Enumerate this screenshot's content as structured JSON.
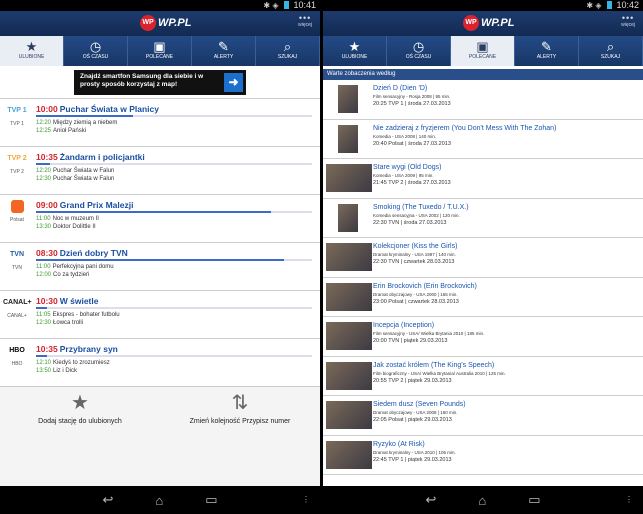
{
  "left": {
    "status_time": "10:41",
    "logo_text": "WP.PL",
    "more_label": "więcej",
    "tabs": [
      {
        "label": "ULUBIONE",
        "icon": "star-icon"
      },
      {
        "label": "OŚ CZASU",
        "icon": "clock-icon"
      },
      {
        "label": "POLECANE",
        "icon": "tv-icon"
      },
      {
        "label": "ALERTY",
        "icon": "pin-icon"
      },
      {
        "label": "SZUKAJ",
        "icon": "search-icon"
      }
    ],
    "ad_text": "Znajdź smartfon Samsung dla siebie i w prosty sposób korzystaj z map!",
    "channels": [
      {
        "name": "TVP 1",
        "logo": "TVP 1",
        "logo_color": "#4aa3df",
        "now_time": "10:00",
        "now_title": "Puchar Świata w Planicy",
        "progress": 0.35,
        "next": [
          {
            "time": "12:20",
            "title": "Między ziemią a niebem"
          },
          {
            "time": "12:25",
            "title": "Anioł Pański"
          }
        ]
      },
      {
        "name": "TVP 2",
        "logo": "TVP 2",
        "logo_color": "#f2a93b",
        "now_time": "10:35",
        "now_title": "Żandarm i policjantki",
        "progress": 0.05,
        "next": [
          {
            "time": "12:20",
            "title": "Puchar Świata w Falun"
          },
          {
            "time": "12:30",
            "title": "Puchar Świata w Falun"
          }
        ]
      },
      {
        "name": "Polsat",
        "logo": "",
        "logo_color": "#f26522",
        "now_time": "09:00",
        "now_title": "Grand Prix Malezji",
        "progress": 0.85,
        "next": [
          {
            "time": "11:00",
            "title": "Noc w muzeum II"
          },
          {
            "time": "13:30",
            "title": "Doktor Dolittle II"
          }
        ]
      },
      {
        "name": "TVN",
        "logo": "TVN",
        "logo_color": "#1f5fa8",
        "now_time": "08:30",
        "now_title": "Dzień dobry TVN",
        "progress": 0.9,
        "next": [
          {
            "time": "11:00",
            "title": "Perfekcyjna pani domu"
          },
          {
            "time": "12:00",
            "title": "Co za tydzień"
          }
        ]
      },
      {
        "name": "CANAL+",
        "logo": "CANAL+",
        "logo_color": "#222222",
        "now_time": "10:30",
        "now_title": "W świetle",
        "progress": 0.04,
        "next": [
          {
            "time": "11:05",
            "title": "Ekspres - bohater futbolu"
          },
          {
            "time": "12:30",
            "title": "Łowca trolli"
          }
        ]
      },
      {
        "name": "HBO",
        "logo": "HBO",
        "logo_color": "#000000",
        "now_time": "10:35",
        "now_title": "Przybrany syn",
        "progress": 0.04,
        "next": [
          {
            "time": "12:10",
            "title": "Kiedyś to zrozumiesz"
          },
          {
            "time": "13:50",
            "title": "Liz i Dick"
          }
        ]
      }
    ],
    "add_station": "Dodaj stację do ulubionych",
    "reorder": "Zmień kolejność Przypisz numer"
  },
  "right": {
    "status_time": "10:42",
    "logo_text": "WP.PL",
    "more_label": "więcej",
    "section_title": "Warte zobaczenia według",
    "movies": [
      {
        "title": "Dzień D (Dien 'D)",
        "genre": "Film sensacyjny - Rosja 2008 | 95 min.",
        "time": "20:25 TVP 1  |  środa 27.03.2013"
      },
      {
        "title": "Nie zadzieraj z fryzjerem (You Don't Mess With The Zohan)",
        "genre": "Komedia - USA 2008 | 140 min.",
        "time": "20:40 Polsat  |  środa 27.03.2013"
      },
      {
        "title": "Stare wygi (Old Dogs)",
        "genre": "Komedia - USA 2009 | 95 min.",
        "time": "21:45 TVP 2  |  środa 27.03.2013"
      },
      {
        "title": "Smoking (The Tuxedo /  T.U.X.)",
        "genre": "Komedia sensacyjna - USA 2002 | 120 min.",
        "time": "22:30 TVN  |  środa 27.03.2013"
      },
      {
        "title": "Kolekcjoner (Kiss the Girls)",
        "genre": "Dramat kryminalny - USA 1997 | 140 min.",
        "time": "22:30 TVN  |  czwartek 28.03.2013"
      },
      {
        "title": "Erin Brockovich (Erin Brockovich)",
        "genre": "Dramat obyczajowy - USA 2000 | 165 min.",
        "time": "23:00 Polsat  |  czwartek 28.03.2013"
      },
      {
        "title": "Incepcja (Inception)",
        "genre": "Film sensacyjny - USA/ Wielka Brytania 2010 | 185 min.",
        "time": "20:00 TVN  |  piątek 29.03.2013"
      },
      {
        "title": "Jak zostać królem (The King's Speech)",
        "genre": "Film biograficzny - USA/ Wielka Brytania/ Australia 2010 | 125 min.",
        "time": "20:55 TVP 2  |  piątek 29.03.2013"
      },
      {
        "title": "Siedem dusz (Seven Pounds)",
        "genre": "Dramat obyczajowy - USA 2008 | 160 min.",
        "time": "22:05 Polsat  |  piątek 29.03.2013"
      },
      {
        "title": "Ryzyko (At Risk)",
        "genre": "Dramat kryminalny - USA 2010 | 105 min.",
        "time": "22:45 TVP 1  |  piątek 29.03.2013"
      }
    ]
  }
}
